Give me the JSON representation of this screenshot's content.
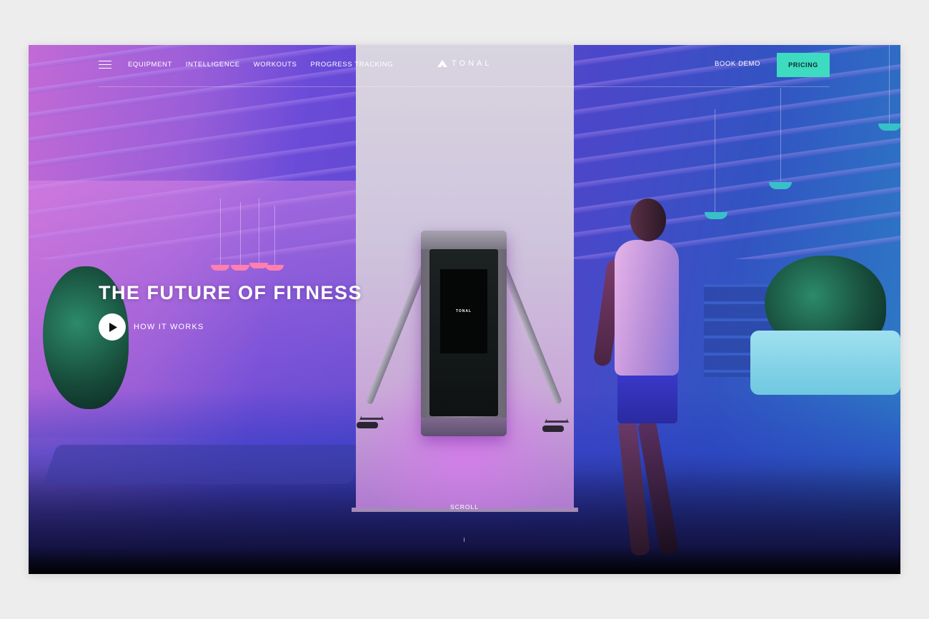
{
  "nav": {
    "menu_icon": "hamburger-menu-icon",
    "links": [
      "EQUIPMENT",
      "INTELLIGENCE",
      "WORKOUTS",
      "PROGRESS TRACKING"
    ],
    "logo_text": "TONAL",
    "book_demo": "BOOK DEMO",
    "pricing": "PRICING"
  },
  "hero": {
    "title": "THE FUTURE OF FITNESS",
    "cta_label": "HOW IT WORKS",
    "cta_icon": "play-icon",
    "device_logo": "TONAL",
    "scroll_label": "SCROLL"
  },
  "colors": {
    "accent": "#3ddbc0",
    "text": "#ffffff"
  }
}
